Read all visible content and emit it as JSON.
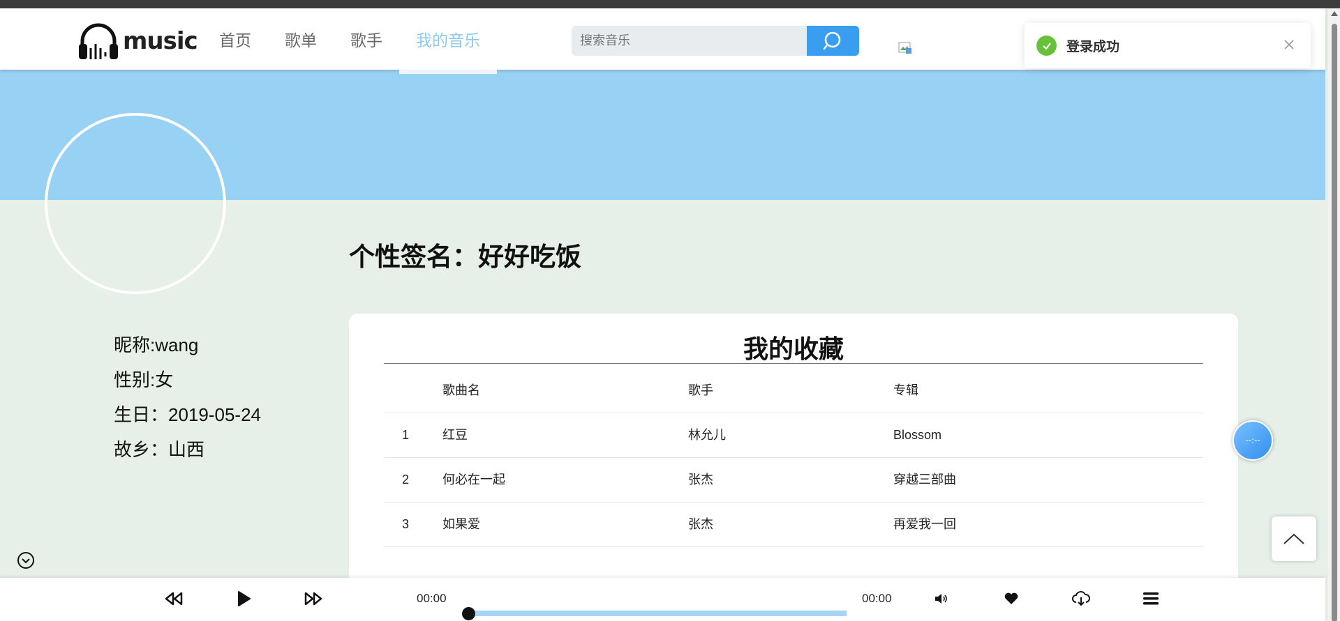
{
  "header": {
    "logo_text": "music",
    "nav": [
      "首页",
      "歌单",
      "歌手",
      "我的音乐"
    ],
    "active_nav": "我的音乐",
    "search_placeholder": "搜索音乐"
  },
  "toast": {
    "text": "登录成功"
  },
  "signature": "个性签名：好好吃饭",
  "profile": {
    "nickname": "昵称:wang",
    "gender": "性别:女",
    "birthday": "生日：2019-05-24",
    "hometown": "故乡：山西"
  },
  "favorites": {
    "title": "我的收藏",
    "columns": [
      "",
      "歌曲名",
      "歌手",
      "专辑"
    ],
    "rows": [
      {
        "index": "1",
        "song": "红豆",
        "singer": "林允儿",
        "album": "Blossom"
      },
      {
        "index": "2",
        "song": "何必在一起",
        "singer": "张杰",
        "album": "穿越三部曲"
      },
      {
        "index": "3",
        "song": "如果爱",
        "singer": "张杰",
        "album": "再爱我一回"
      }
    ]
  },
  "float_widget": {
    "text": "--:--"
  },
  "player": {
    "current_time": "00:00",
    "duration": "00:00",
    "progress": 0
  },
  "colors": {
    "banner": "#97d1f4",
    "page_bg": "#e6efe8",
    "accent": "#3a9ef0",
    "active_nav": "#8cc9ec",
    "success": "#67c23a"
  }
}
